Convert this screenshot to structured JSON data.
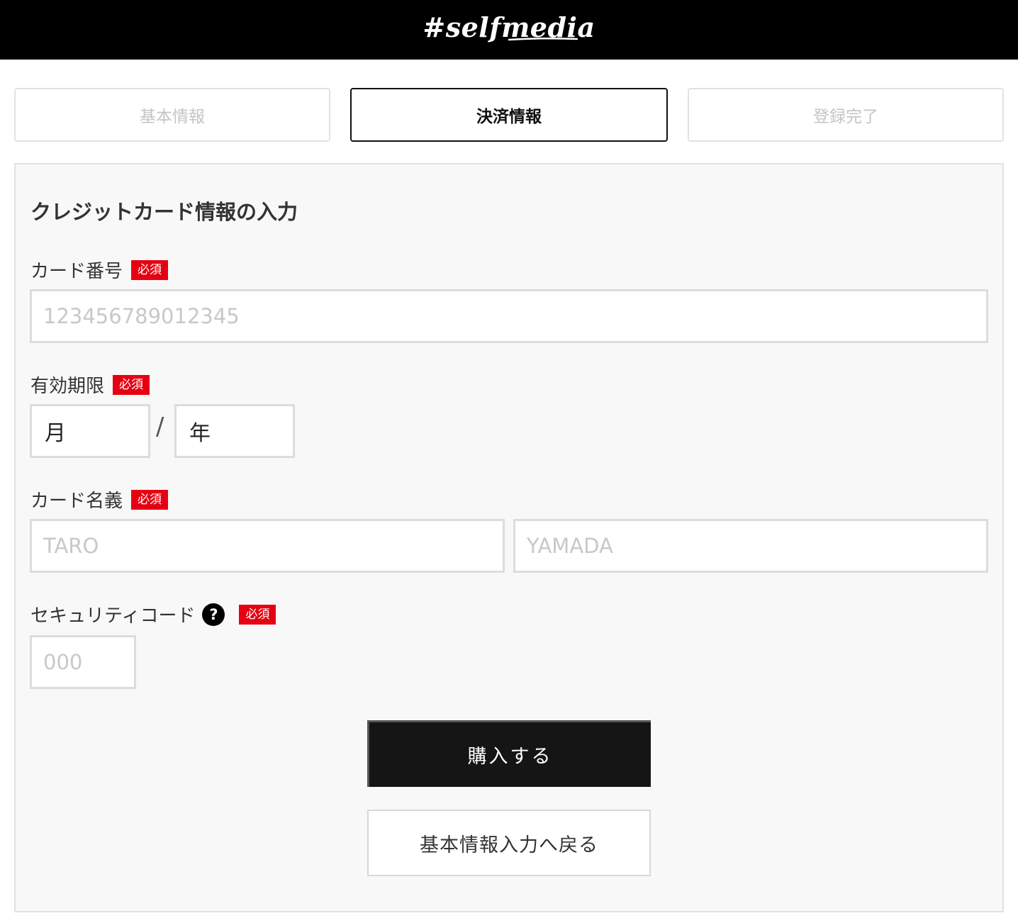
{
  "header": {
    "logo_text": "#selfmedia"
  },
  "steps": [
    {
      "label": "基本情報",
      "state": "inactive"
    },
    {
      "label": "決済情報",
      "state": "active"
    },
    {
      "label": "登録完了",
      "state": "inactive"
    }
  ],
  "form": {
    "title": "クレジットカード情報の入力",
    "required_badge": "必須",
    "card_number": {
      "label": "カード番号",
      "placeholder": "123456789012345"
    },
    "expiry": {
      "label": "有効期限",
      "month_value": "月",
      "separator": "/",
      "year_value": "年"
    },
    "card_name": {
      "label": "カード名義",
      "first_placeholder": "TARO",
      "last_placeholder": "YAMADA"
    },
    "security_code": {
      "label": "セキュリティコード",
      "help_glyph": "?",
      "placeholder": "000"
    }
  },
  "actions": {
    "purchase_label": "購入する",
    "back_label": "基本情報入力へ戻る"
  },
  "colors": {
    "header_bg": "#000000",
    "required_badge": "#e60012",
    "primary_button": "#151515",
    "panel_bg": "#f8f8f8"
  }
}
